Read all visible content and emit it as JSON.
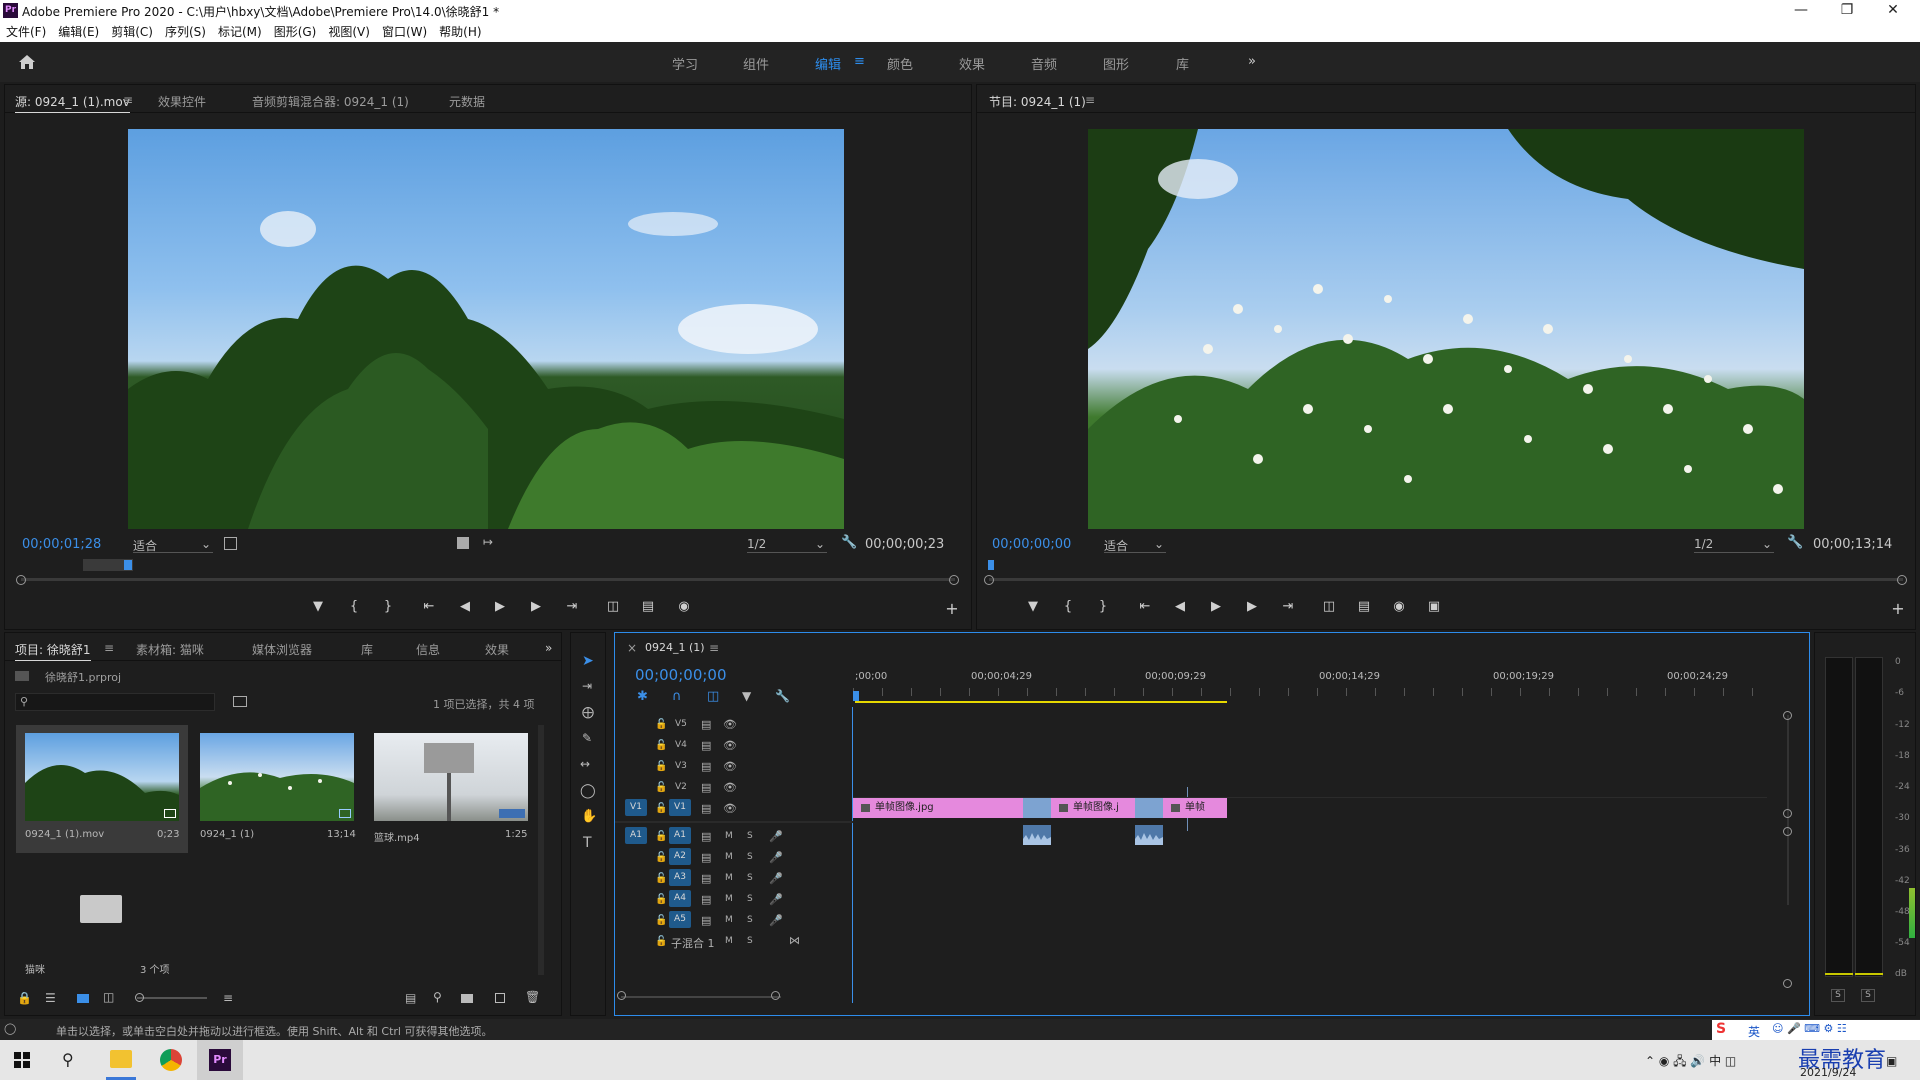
{
  "window": {
    "title": "Adobe Premiere Pro 2020 - C:\\用户\\hbxy\\文档\\Adobe\\Premiere Pro\\14.0\\徐晓舒1 *",
    "logo": "Pr"
  },
  "menu": [
    "文件(F)",
    "编辑(E)",
    "剪辑(C)",
    "序列(S)",
    "标记(M)",
    "图形(G)",
    "视图(V)",
    "窗口(W)",
    "帮助(H)"
  ],
  "workspaces": [
    "学习",
    "组件",
    "编辑",
    "颜色",
    "效果",
    "音频",
    "图形",
    "库"
  ],
  "active_workspace": "编辑",
  "source": {
    "tabs": [
      "源: 0924_1 (1).mov",
      "效果控件",
      "音频剪辑混合器: 0924_1 (1)",
      "元数据"
    ],
    "timecode": "00;00;01;28",
    "fit": "适合",
    "resolution": "1/2",
    "duration": "00;00;00;23"
  },
  "program": {
    "tab": "节目: 0924_1 (1)",
    "timecode": "00;00;00;00",
    "fit": "适合",
    "resolution": "1/2",
    "duration": "00;00;13;14"
  },
  "project": {
    "tabs": [
      "项目: 徐晓舒1",
      "素材箱: 猫咪",
      "媒体浏览器",
      "库",
      "信息",
      "效果"
    ],
    "file": "徐晓舒1.prproj",
    "selection": "1 项已选择，共 4 项",
    "items": [
      {
        "name": "0924_1 (1).mov",
        "duration": "0;23"
      },
      {
        "name": "0924_1 (1)",
        "duration": "13;14"
      },
      {
        "name": "篮球.mp4",
        "duration": "1:25"
      }
    ],
    "bin": {
      "name": "猫咪",
      "count": "3 个项"
    }
  },
  "timeline": {
    "tab": "0924_1 (1)",
    "timecode": "00;00;00;00",
    "ruler": [
      ";00;00",
      "00;00;04;29",
      "00;00;09;29",
      "00;00;14;29",
      "00;00;19;29",
      "00;00;24;29"
    ],
    "video_tracks": [
      "V5",
      "V4",
      "V3",
      "V2",
      "V1"
    ],
    "audio_tracks": [
      "A1",
      "A2",
      "A3",
      "A4",
      "A5"
    ],
    "submix": "子混合 1",
    "source_v": "V1",
    "source_a": "A1",
    "clips": [
      "单帧图像.jpg",
      "单帧图像.j",
      "单帧"
    ],
    "mute": "M",
    "solo": "S"
  },
  "meter": {
    "scale": [
      "0",
      "-6",
      "-12",
      "-18",
      "-24",
      "-30",
      "-36",
      "-42",
      "-48",
      "-54",
      "dB"
    ],
    "solo": [
      "S",
      "S"
    ]
  },
  "status": "单击以选择，或单击空白处并拖动以进行框选。使用 Shift、Alt 和 Ctrl 可获得其他选项。",
  "tray": {
    "ime": "英",
    "date": "2021/9/24",
    "watermark": "最需教育"
  },
  "colors": {
    "accent": "#2d8ceb",
    "clip_pink": "#e589dd",
    "clip_blue": "#7da3d1",
    "track_target": "#1f5a8c"
  }
}
